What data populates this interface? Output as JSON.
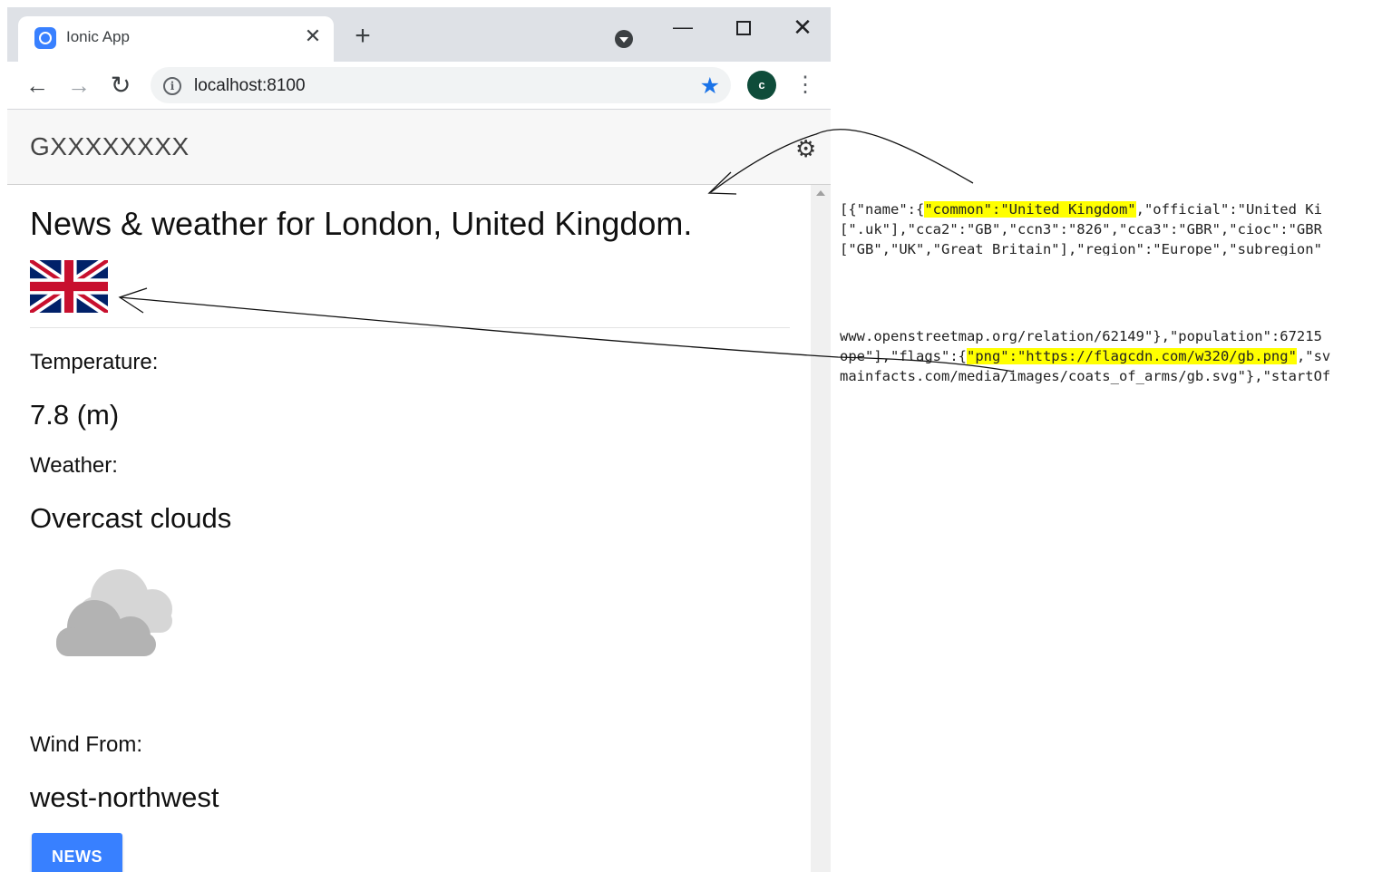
{
  "browser": {
    "tab_title": "Ionic App",
    "url": "localhost:8100",
    "profile_initial": "c"
  },
  "app": {
    "title": "GXXXXXXXX"
  },
  "main": {
    "headline": "News & weather for London, United Kingdom.",
    "temperature_label": "Temperature:",
    "temperature_value": "7.8 (m)",
    "weather_label": "Weather:",
    "weather_value": "Overcast clouds",
    "wind_label": "Wind From:",
    "wind_value": "west-northwest",
    "news_button": "NEWS"
  },
  "json_snippet_1": {
    "line1_pre": "[{\"name\":{",
    "line1_hl": "\"common\":\"United Kingdom\"",
    "line1_post": ",\"official\":\"United Ki",
    "line2": "[\".uk\"],\"cca2\":\"GB\",\"ccn3\":\"826\",\"cca3\":\"GBR\",\"cioc\":\"GBR",
    "line3": "[\"GB\",\"UK\",\"Great Britain\"],\"region\":\"Europe\",\"subregion\""
  },
  "json_snippet_2": {
    "line1": "www.openstreetmap.org/relation/62149\"},\"population\":67215",
    "line2_pre": "ope\"],\"flags\":{",
    "line2_hl": "\"png\":\"https://flagcdn.com/w320/gb.png\"",
    "line2_post": ",\"sv",
    "line3": "mainfacts.com/media/images/coats_of_arms/gb.svg\"},\"startOf"
  },
  "colors": {
    "ionic_primary": "#3880ff",
    "chrome_star": "#1a73e8",
    "highlight": "#ffff00"
  },
  "icons": [
    "ionic-favicon",
    "close-icon",
    "plus-icon",
    "tab-search-icon",
    "minimize-icon",
    "maximize-icon",
    "window-close-icon",
    "back-arrow-icon",
    "forward-arrow-icon",
    "reload-icon",
    "info-icon",
    "star-icon",
    "kebab-menu-icon",
    "gear-icon",
    "uk-flag",
    "cloud-icon"
  ]
}
